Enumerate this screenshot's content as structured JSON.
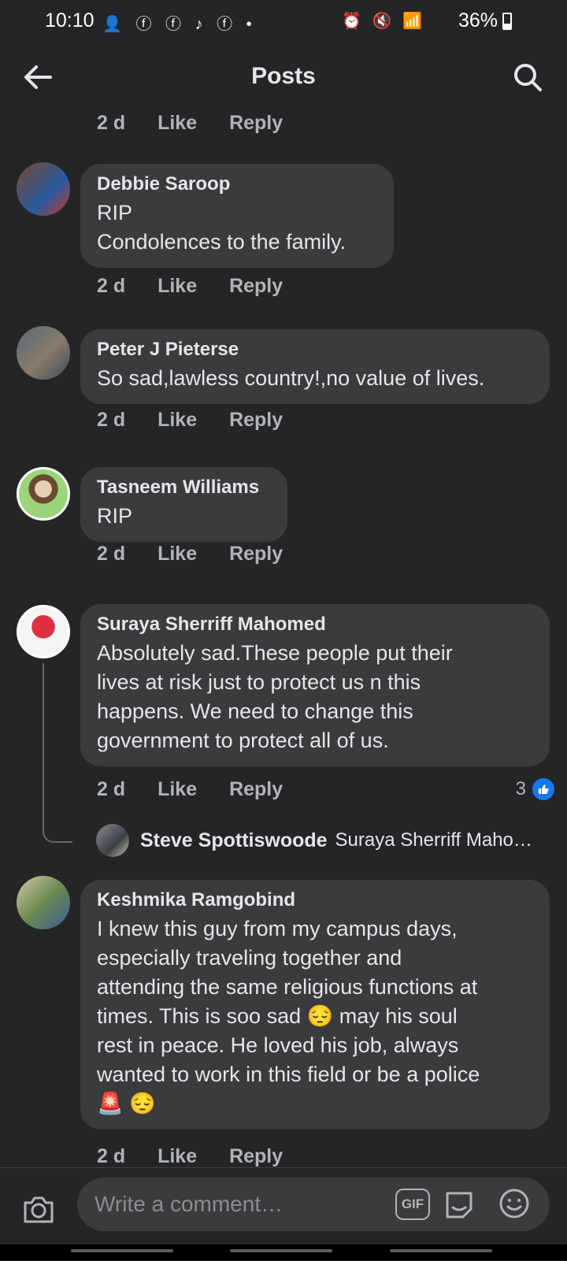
{
  "status_bar": {
    "time": "10:10",
    "battery": "36%"
  },
  "header": {
    "title": "Posts"
  },
  "meta": {
    "age": "2 d",
    "like": "Like",
    "reply": "Reply"
  },
  "comments": [
    {
      "name": "Debbie Saroop",
      "text": "RIP\nCondolences to the family."
    },
    {
      "name": "Peter J Pieterse",
      "text": "So sad,lawless country!,no value of lives."
    },
    {
      "name": "Tasneem Williams",
      "text": "RIP"
    },
    {
      "name": "Suraya Sherriff Mahomed",
      "text": "Absolutely sad.These people put their\nlives at risk just to protect us n this\nhappens. We need to change this\ngovernment to protect all of us."
    },
    {
      "name": "Keshmika Ramgobind",
      "text": "I knew this guy from my campus days,\nespecially traveling together and\nattending the same religious functions at\ntimes. This is soo sad 😔 may his soul\nrest in peace. He loved his job, always\nwanted to work in this field or be a police\n🚨 😔"
    }
  ],
  "reaction_count": "3",
  "reply_preview": {
    "name": "Steve Spottiswoode",
    "text": "Suraya Sherriff Maho…"
  },
  "composer": {
    "placeholder": "Write a comment…",
    "gif_label": "GIF"
  },
  "colors": {
    "background": "#242526",
    "bubble": "#3a3b3c",
    "like_blue": "#1877f2"
  }
}
